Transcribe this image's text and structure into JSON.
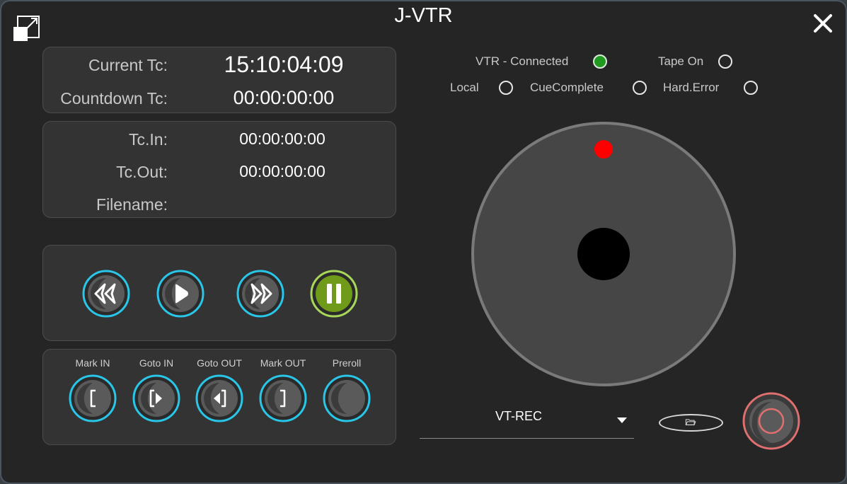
{
  "window": {
    "title": "J-VTR"
  },
  "timecode": {
    "current_label": "Current Tc:",
    "current_value": "15:10:04:09",
    "countdown_label": "Countdown Tc:",
    "countdown_value": "00:00:00:00"
  },
  "clip": {
    "tc_in_label": "Tc.In:",
    "tc_in_value": "00:00:00:00",
    "tc_out_label": "Tc.Out:",
    "tc_out_value": "00:00:00:00",
    "filename_label": "Filename:",
    "filename_value": ""
  },
  "transport": [
    "rewind-icon",
    "play-icon",
    "fast-forward-icon",
    "pause-icon"
  ],
  "marks": {
    "mark_in": "Mark IN",
    "goto_in": "Goto IN",
    "goto_out": "Goto OUT",
    "mark_out": "Mark OUT",
    "preroll": "Preroll"
  },
  "status": {
    "vtr_connected": "VTR - Connected",
    "tape_on": "Tape On",
    "local": "Local",
    "cue_complete": "CueComplete",
    "hard_error": "Hard.Error",
    "vtr_connected_on": true
  },
  "device_select": {
    "value": "VT-REC"
  },
  "colors": {
    "accent_cyan": "#29c6e8",
    "pause_green": "#6f9a1a",
    "led_green": "#1f9a1f",
    "record_red": "#e07070",
    "jog_marker": "#ff0000"
  }
}
